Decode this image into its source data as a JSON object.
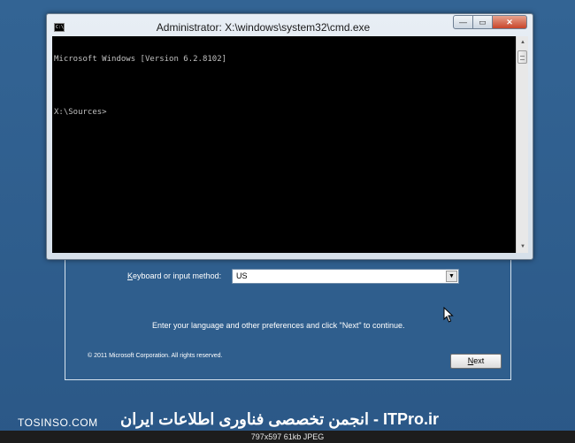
{
  "cmd": {
    "title": "Administrator: X:\\windows\\system32\\cmd.exe",
    "icon_text": "C:\\",
    "lines": [
      "Microsoft Windows [Version 6.2.8102]",
      "",
      "X:\\Sources>"
    ],
    "controls": {
      "minimize": "—",
      "maximize": "▭",
      "close": "✕"
    },
    "scroll_up": "▲",
    "scroll_down": "▼"
  },
  "setup": {
    "keyboard_label_pre": "",
    "keyboard_label_hotkey": "K",
    "keyboard_label_post": "eyboard or input method:",
    "keyboard_value": "US",
    "hint": "Enter your language and other preferences and click \"Next\" to continue.",
    "copyright": "© 2011 Microsoft Corporation. All rights reserved.",
    "next_hotkey": "N",
    "next_rest": "ext"
  },
  "watermark": {
    "left": "TOSINSO.COM",
    "right": "انجمن تخصصی فناوری اطلاعات ایران - ITPro.ir"
  },
  "image_info": "797x597  61kb  JPEG",
  "colors": {
    "desktop": "#2f5d8a",
    "console_bg": "#000000",
    "console_fg": "#c0c0c0",
    "close_button": "#c8442a"
  }
}
